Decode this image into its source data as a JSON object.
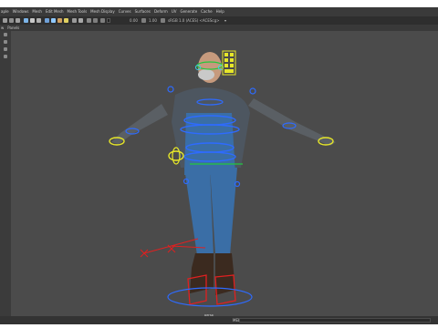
{
  "menubar": {
    "items": [
      "aple",
      "Windows",
      "Mesh",
      "Edit Mesh",
      "Mesh Tools",
      "Mesh Display",
      "Curves",
      "Surfaces",
      "Deform",
      "UV",
      "Generate",
      "Cache",
      "Help"
    ]
  },
  "statusline": {
    "value_a": "0.00",
    "value_b": "1.00",
    "render_setting": "sRGB 1.0 (ACES) <ACEScg>"
  },
  "panel_menus": [
    "w",
    "Panels"
  ],
  "viewport": {
    "camera_label": "persp"
  },
  "commandline": {
    "label": "MEL"
  },
  "colors": {
    "app_bg": "#444444",
    "viewport_bg": "#4b4b4b",
    "control_blue": "#2e6bff",
    "control_yellow": "#e6e629",
    "control_red": "#e02020",
    "control_green": "#23c83c",
    "control_cyan": "#37d6e6"
  }
}
